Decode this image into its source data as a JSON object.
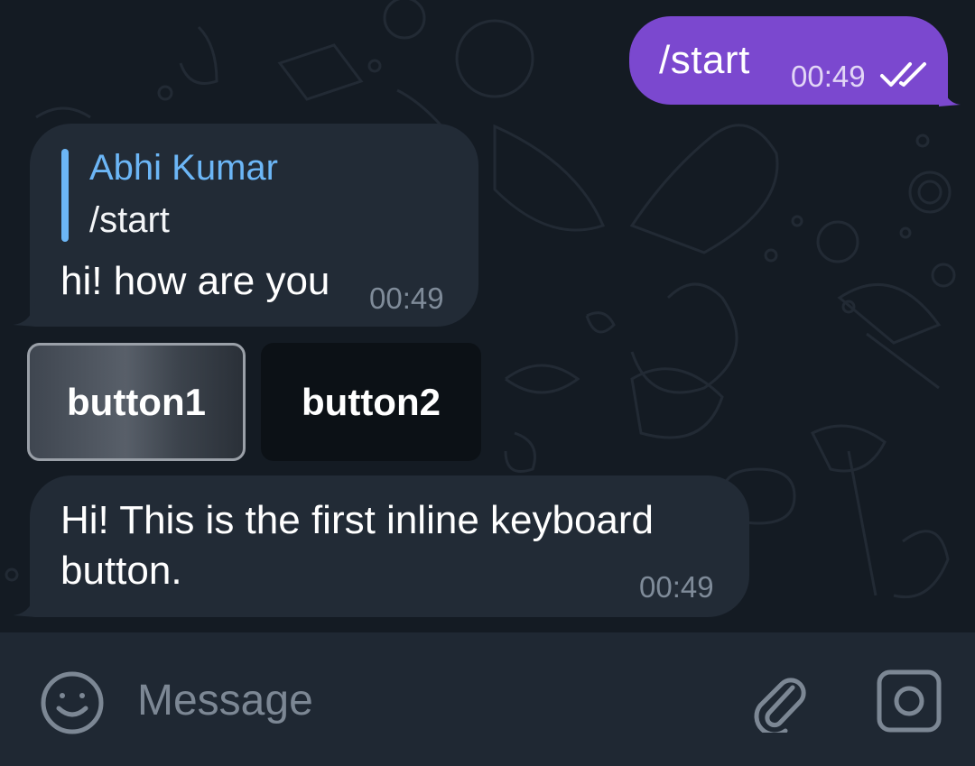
{
  "colors": {
    "background": "#141b23",
    "outgoing_bubble": "#7b48cf",
    "incoming_bubble": "#222b36",
    "accent_blue": "#6cb6f6",
    "input_bar": "#1f2833"
  },
  "messages": [
    {
      "direction": "outgoing",
      "text": "/start",
      "time": "00:49",
      "status_icon": "double-check-icon"
    },
    {
      "direction": "incoming",
      "reply": {
        "sender": "Abhi Kumar",
        "text": "/start"
      },
      "text": "hi! how are you",
      "time": "00:49"
    },
    {
      "direction": "incoming",
      "text": "Hi! This is the first inline keyboard button.",
      "time": "00:49"
    }
  ],
  "inline_keyboard": [
    {
      "label": "button1",
      "state": "pressed"
    },
    {
      "label": "button2",
      "state": "normal"
    }
  ],
  "composer": {
    "placeholder": "Message",
    "value": "",
    "icons": [
      "smile-icon",
      "paperclip-icon",
      "camera-icon"
    ]
  }
}
